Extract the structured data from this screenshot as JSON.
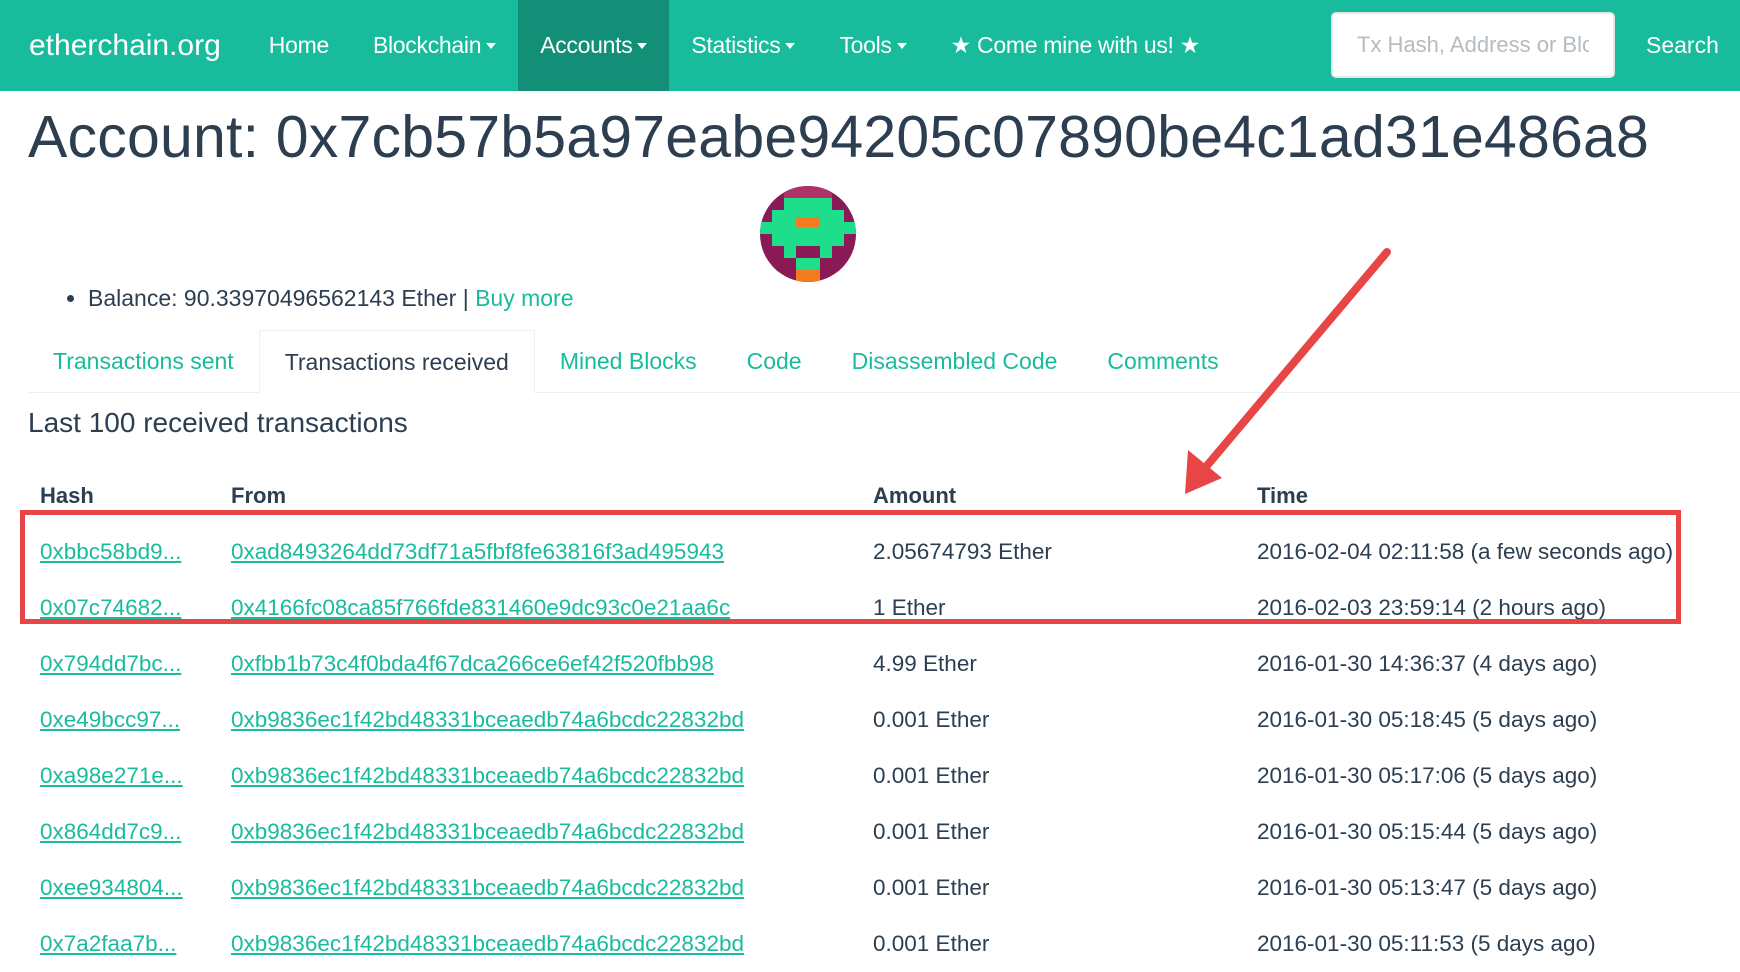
{
  "navbar": {
    "brand": "etherchain.org",
    "items": [
      {
        "label": "Home",
        "dropdown": false,
        "active": false
      },
      {
        "label": "Blockchain",
        "dropdown": true,
        "active": false
      },
      {
        "label": "Accounts",
        "dropdown": true,
        "active": true
      },
      {
        "label": "Statistics",
        "dropdown": true,
        "active": false
      },
      {
        "label": "Tools",
        "dropdown": true,
        "active": false
      },
      {
        "label": "★ Come mine with us! ★",
        "dropdown": false,
        "active": false
      }
    ],
    "search_placeholder": "Tx Hash, Address or Block",
    "search_button": "Search",
    "color": "#18bc9c"
  },
  "account": {
    "title": "Account: 0x7cb57b5a97eabe94205c07890be4c1ad31e486a8",
    "balance_text": "Balance: 90.33970496562143 Ether | ",
    "buy_more": "Buy more"
  },
  "tabs": [
    {
      "label": "Transactions sent",
      "active": false
    },
    {
      "label": "Transactions received",
      "active": true
    },
    {
      "label": "Mined Blocks",
      "active": false
    },
    {
      "label": "Code",
      "active": false
    },
    {
      "label": "Disassembled Code",
      "active": false
    },
    {
      "label": "Comments",
      "active": false
    }
  ],
  "section_heading": "Last 100 received transactions",
  "table": {
    "headers": {
      "hash": "Hash",
      "from": "From",
      "amount": "Amount",
      "time": "Time"
    },
    "rows": [
      {
        "hash": "0xbbc58bd9...",
        "from": "0xad8493264dd73df71a5fbf8fe63816f3ad495943",
        "amount": "2.05674793 Ether",
        "time": "2016-02-04 02:11:58 (a few seconds ago)"
      },
      {
        "hash": "0x07c74682...",
        "from": "0x4166fc08ca85f766fde831460e9dc93c0e21aa6c",
        "amount": "1 Ether",
        "time": "2016-02-03 23:59:14 (2 hours ago)"
      },
      {
        "hash": "0x794dd7bc...",
        "from": "0xfbb1b73c4f0bda4f67dca266ce6ef42f520fbb98",
        "amount": "4.99 Ether",
        "time": "2016-01-30 14:36:37 (4 days ago)"
      },
      {
        "hash": "0xe49bcc97...",
        "from": "0xb9836ec1f42bd48331bceaedb74a6bcdc22832bd",
        "amount": "0.001 Ether",
        "time": "2016-01-30 05:18:45 (5 days ago)"
      },
      {
        "hash": "0xa98e271e...",
        "from": "0xb9836ec1f42bd48331bceaedb74a6bcdc22832bd",
        "amount": "0.001 Ether",
        "time": "2016-01-30 05:17:06 (5 days ago)"
      },
      {
        "hash": "0x864dd7c9...",
        "from": "0xb9836ec1f42bd48331bceaedb74a6bcdc22832bd",
        "amount": "0.001 Ether",
        "time": "2016-01-30 05:15:44 (5 days ago)"
      },
      {
        "hash": "0xee934804...",
        "from": "0xb9836ec1f42bd48331bceaedb74a6bcdc22832bd",
        "amount": "0.001 Ether",
        "time": "2016-01-30 05:13:47 (5 days ago)"
      },
      {
        "hash": "0x7a2faa7b...",
        "from": "0xb9836ec1f42bd48331bceaedb74a6bcdc22832bd",
        "amount": "0.001 Ether",
        "time": "2016-01-30 05:11:53 (5 days ago)"
      }
    ]
  },
  "annotation": {
    "color": "#e84646",
    "highlighted_rows": 2
  },
  "icons": {
    "avatar": "identicon-avatar",
    "caret": "caret-down-icon",
    "bullet": "bullet-icon"
  }
}
